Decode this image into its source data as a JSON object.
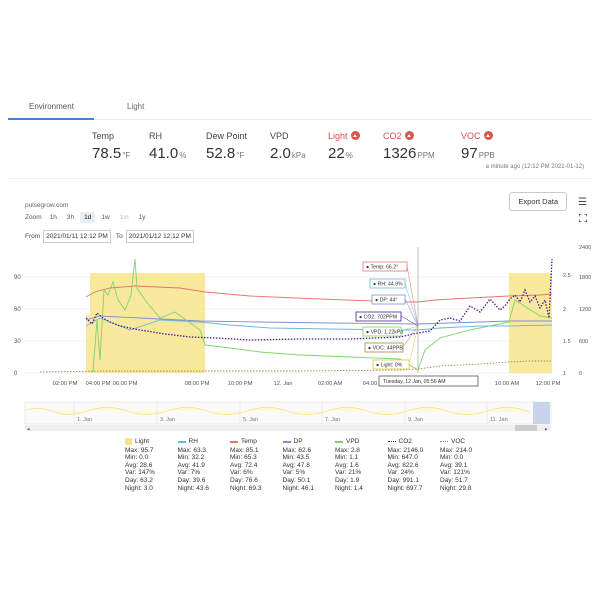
{
  "tabs": [
    {
      "label": "Environment",
      "active": true
    },
    {
      "label": "Light",
      "active": false
    }
  ],
  "metrics": [
    {
      "label": "Temp",
      "value": "78.5",
      "unit": "°F",
      "alert": false
    },
    {
      "label": "RH",
      "value": "41.0",
      "unit": "%",
      "alert": false
    },
    {
      "label": "Dew Point",
      "value": "52.8",
      "unit": "°F",
      "alert": false
    },
    {
      "label": "VPD",
      "value": "2.0",
      "unit": "kPa",
      "alert": false
    },
    {
      "label": "Light",
      "value": "22",
      "unit": "%",
      "alert": true
    },
    {
      "label": "CO2",
      "value": "1326",
      "unit": "PPM",
      "alert": true
    },
    {
      "label": "VOC",
      "value": "97",
      "unit": "PPB",
      "alert": true
    }
  ],
  "updated": "a minute ago (12:12 PM 2021-01-12)",
  "chart_header": {
    "site": "pulsegrow.com",
    "zoom_label": "Zoom",
    "zoom_options": [
      "1h",
      "3h",
      "1d",
      "1w",
      "1m",
      "1y"
    ],
    "zoom_selected": "1d",
    "zoom_disabled": [
      "1m"
    ],
    "from_label": "From",
    "from_value": "2021/01/11 12:12 PM",
    "to_label": "To",
    "to_value": "2021/01/12 12:12 PM",
    "export_label": "Export Data",
    "menu_icon": "hamburger-menu-icon",
    "expand_icon": "fullscreen-icon"
  },
  "chart_data": {
    "type": "line",
    "x_tick_labels": [
      "02:00 PM",
      "04:00 PM",
      "06:00 PM",
      "08:00 PM",
      "10:00 PM",
      "12. Jan",
      "02:00 AM",
      "04:00 AM",
      "06:00 AM",
      "08:00 AM",
      "10:00 AM",
      "12:00 PM"
    ],
    "y_left_ticks": [
      "0",
      "30",
      "60",
      "90"
    ],
    "y_right_ticks_1": [
      "0",
      "600",
      "1200",
      "1800",
      "2400"
    ],
    "y_right_ticks_2": [
      "1",
      "1.5",
      "2",
      "2.5"
    ],
    "series": [
      {
        "name": "Light",
        "color": "#f7e58c",
        "style": "area"
      },
      {
        "name": "RH",
        "color": "#6cb8e0",
        "style": "solid"
      },
      {
        "name": "Temp",
        "color": "#e8736b",
        "style": "solid"
      },
      {
        "name": "DP",
        "color": "#7b8fd6",
        "style": "solid"
      },
      {
        "name": "VPD",
        "color": "#7ed36c",
        "style": "solid"
      },
      {
        "name": "CO2",
        "color": "#4b1f96",
        "style": "dotted"
      },
      {
        "name": "VOC",
        "color": "#a08a45",
        "style": "dotted"
      }
    ],
    "tooltip": {
      "items": [
        {
          "text": "Temp: 66.2°",
          "color": "#e8736b"
        },
        {
          "text": "RH: 44.9%",
          "color": "#6cb8e0"
        },
        {
          "text": "DP: 44°",
          "color": "#7b8fd6"
        },
        {
          "text": "CO2: 702PPM",
          "color": "#4b1f96"
        },
        {
          "text": "VPD: 1.22kPa",
          "color": "#7ed36c"
        },
        {
          "text": "VOC: 44PPB",
          "color": "#a08a45"
        },
        {
          "text": "Light: 0%",
          "color": "#e0c84a"
        }
      ],
      "time": "Tuesday, 12 Jan, 05:56 AM"
    },
    "navigator_labels": [
      "1. Jan",
      "3. Jan",
      "5. Jan",
      "7. Jan",
      "9. Jan",
      "11. Jan"
    ]
  },
  "legend": [
    {
      "name": "Light",
      "color": "#f7e58c",
      "style": "box",
      "stats": [
        "Max: 95.7",
        "Min: 0.0",
        "Avg: 28.6",
        "Var: 147%",
        "Day: 63.2",
        "Night: 3.0"
      ]
    },
    {
      "name": "RH",
      "color": "#6cb8e0",
      "style": "solid",
      "stats": [
        "Max: 63.3",
        "Min: 32.2",
        "Avg: 41.9",
        "Var: 7%",
        "Day: 39.6",
        "Night: 43.6"
      ]
    },
    {
      "name": "Temp",
      "color": "#e8736b",
      "style": "solid",
      "stats": [
        "Max: 85.1",
        "Min: 65.3",
        "Avg: 72.4",
        "Var: 6%",
        "Day: 76.6",
        "Night: 69.3"
      ]
    },
    {
      "name": "DP",
      "color": "#7b8fd6",
      "style": "solid",
      "stats": [
        "Max: 62.6",
        "Min: 43.5",
        "Avg: 47.8",
        "Var: 5%",
        "Day: 50.1",
        "Night: 46.1"
      ]
    },
    {
      "name": "VPD",
      "color": "#7ed36c",
      "style": "solid",
      "stats": [
        "Max: 2.8",
        "Min: 1.1",
        "Avg: 1.6",
        "Var: 21%",
        "Day: 1.9",
        "Night: 1.4"
      ]
    },
    {
      "name": "CO2",
      "color": "#4b1f96",
      "style": "dotted",
      "stats": [
        "Max: 2146.0",
        "Min: 647.0",
        "Avg: 822.6",
        "Var: 24%",
        "Day: 991.1",
        "Night: 697.7"
      ]
    },
    {
      "name": "VOC",
      "color": "#a08a45",
      "style": "dotted",
      "stats": [
        "Max: 214.0",
        "Min: 0.0",
        "Avg: 39.1",
        "Var: 121%",
        "Day: 51.7",
        "Night: 29.8"
      ]
    }
  ]
}
